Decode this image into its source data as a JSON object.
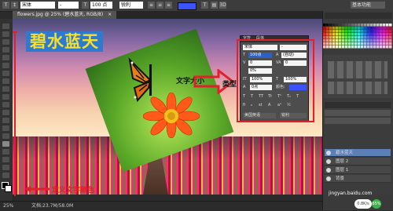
{
  "options_bar": {
    "font_family": "宋体",
    "font_size": "100 点",
    "anti_alias": "锐利",
    "workspace": "基本功能"
  },
  "document": {
    "tab_title": "flowers.jpg @ 25% (碧水蓝天, RGB/8)"
  },
  "canvas": {
    "big_text": "碧水蓝天",
    "size_annotation": "文字大小",
    "type_annotation": "类型",
    "color_annotation": "定义文字颜色"
  },
  "character_panel": {
    "tabs": [
      "字符",
      "段落"
    ],
    "font_family": "宋体",
    "font_style": "-",
    "font_size": "100点",
    "leading": "(自动)",
    "tracking": "0",
    "vertical_scale": "100%",
    "horizontal_scale": "100%",
    "baseline": "0点",
    "color_label": "颜色:",
    "language": "美国英语",
    "anti_alias": "锐利"
  },
  "layers_panel": {
    "items": [
      "碧水蓝天",
      "图层 2",
      "图层 1",
      "背景"
    ]
  },
  "status": {
    "zoom": "25%",
    "doc_size": "文档:23.7M/58.0M"
  },
  "watermark": "jingyan.baidu.com",
  "speed_badge": "0.8K/s",
  "speed_percent": "65%",
  "colors": {
    "accent_red": "#e0202a",
    "text_yellow": "#f6e02a",
    "text_bg_blue": "#2d7ad0",
    "swatch_blue": "#3b52ff"
  }
}
